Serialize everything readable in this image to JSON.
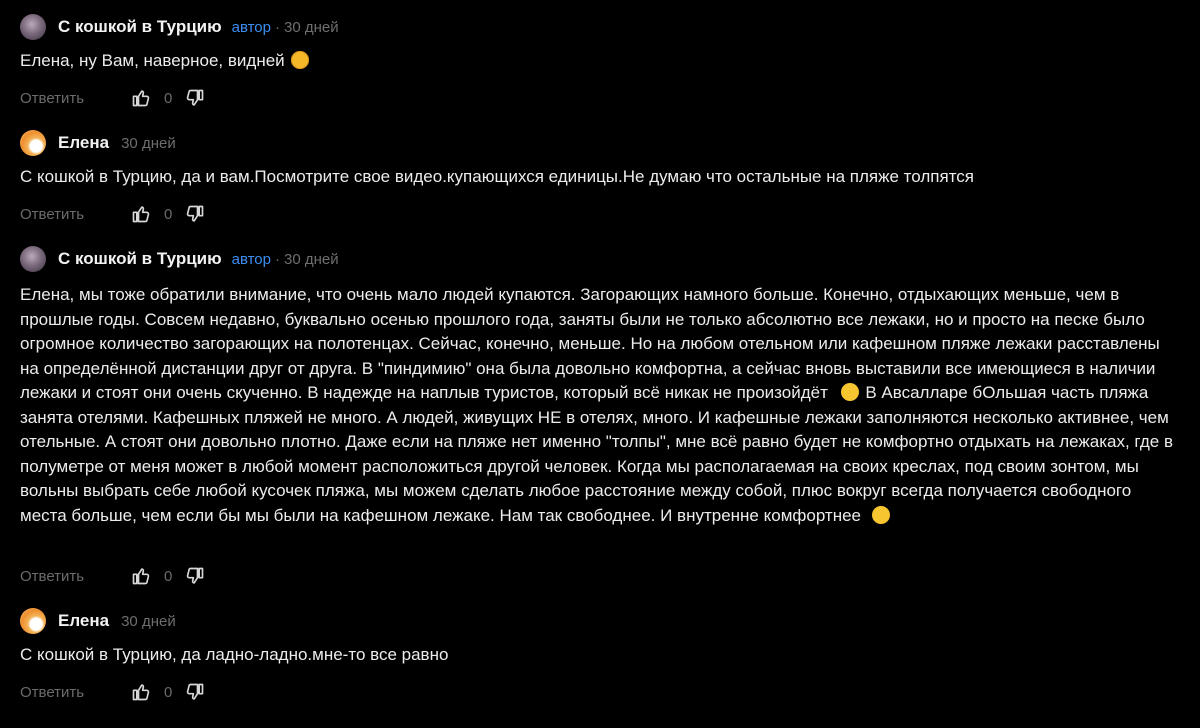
{
  "comments": [
    {
      "author": "С кошкой в Турцию",
      "badge": "автор",
      "separator": "·",
      "time": "30 дней",
      "text": "Елена, ну Вам, наверное, видней",
      "emoji": "laughing-emoji",
      "reply_label": "Ответить",
      "like_count": "0"
    },
    {
      "author": "Елена",
      "time": "30 дней",
      "text": "С кошкой в Турцию, да и вам.Посмотрите свое видео.купающихся единицы.Не думаю что остальные на пляже толпятся",
      "reply_label": "Ответить",
      "like_count": "0"
    },
    {
      "author": "С кошкой в Турцию",
      "badge": "автор",
      "separator": "·",
      "time": "30 дней",
      "text_part1": "Елена, мы тоже обратили внимание, что очень мало людей купаются. Загорающих намного больше. Конечно, отдыхающих меньше, чем в прошлые годы. Совсем недавно, буквально осенью прошлого года, заняты были не только абсолютно все лежаки, но и просто на песке было огромное количество загорающих на полотенцах. Сейчас, конечно, меньше. Но на любом отельном или кафешном пляже лежаки расставлены на определённой дистанции друг от друга. В \"пиндимию\" она была довольно комфортна, а сейчас вновь выставили все имеющиеся в наличии лежаки и стоят они очень скученно. В надежде на наплыв туристов, который всё никак не произойдёт",
      "text_part2": " В Авсалларе бОльшая часть пляжа занята отелями. Кафешных пляжей не много. А людей, живущих НЕ в отелях, много. И кафешные лежаки заполняются несколько активнее, чем отельные. А стоят они довольно плотно. Даже если на пляже нет именно \"толпы\", мне всё равно будет не комфортно отдыхать на лежаках, где в полуметре от меня может в любой момент расположиться другой человек. Когда мы располагаемая на своих креслах, под своим зонтом, мы вольны выбрать себе любой кусочек пляжа, мы можем сделать любое расстояние между собой, плюс вокруг всегда получается свободного места больше, чем если бы мы были на кафешном лежаке. Нам так свободнее. И внутренне комфортнее",
      "emoji1": "slightly-smiling-emoji",
      "emoji2": "smiling-eyes-emoji",
      "reply_label": "Ответить",
      "like_count": "0"
    },
    {
      "author": "Елена",
      "time": "30 дней",
      "text": "С кошкой в Турцию, да ладно-ладно.мне-то все равно",
      "reply_label": "Ответить",
      "like_count": "0"
    }
  ],
  "icons": {
    "like": "thumbs-up-icon",
    "dislike": "thumbs-down-icon"
  },
  "colors": {
    "background": "#000000",
    "author_badge": "#3b8ef0",
    "muted": "#6b6b6b",
    "text": "#ececec"
  }
}
